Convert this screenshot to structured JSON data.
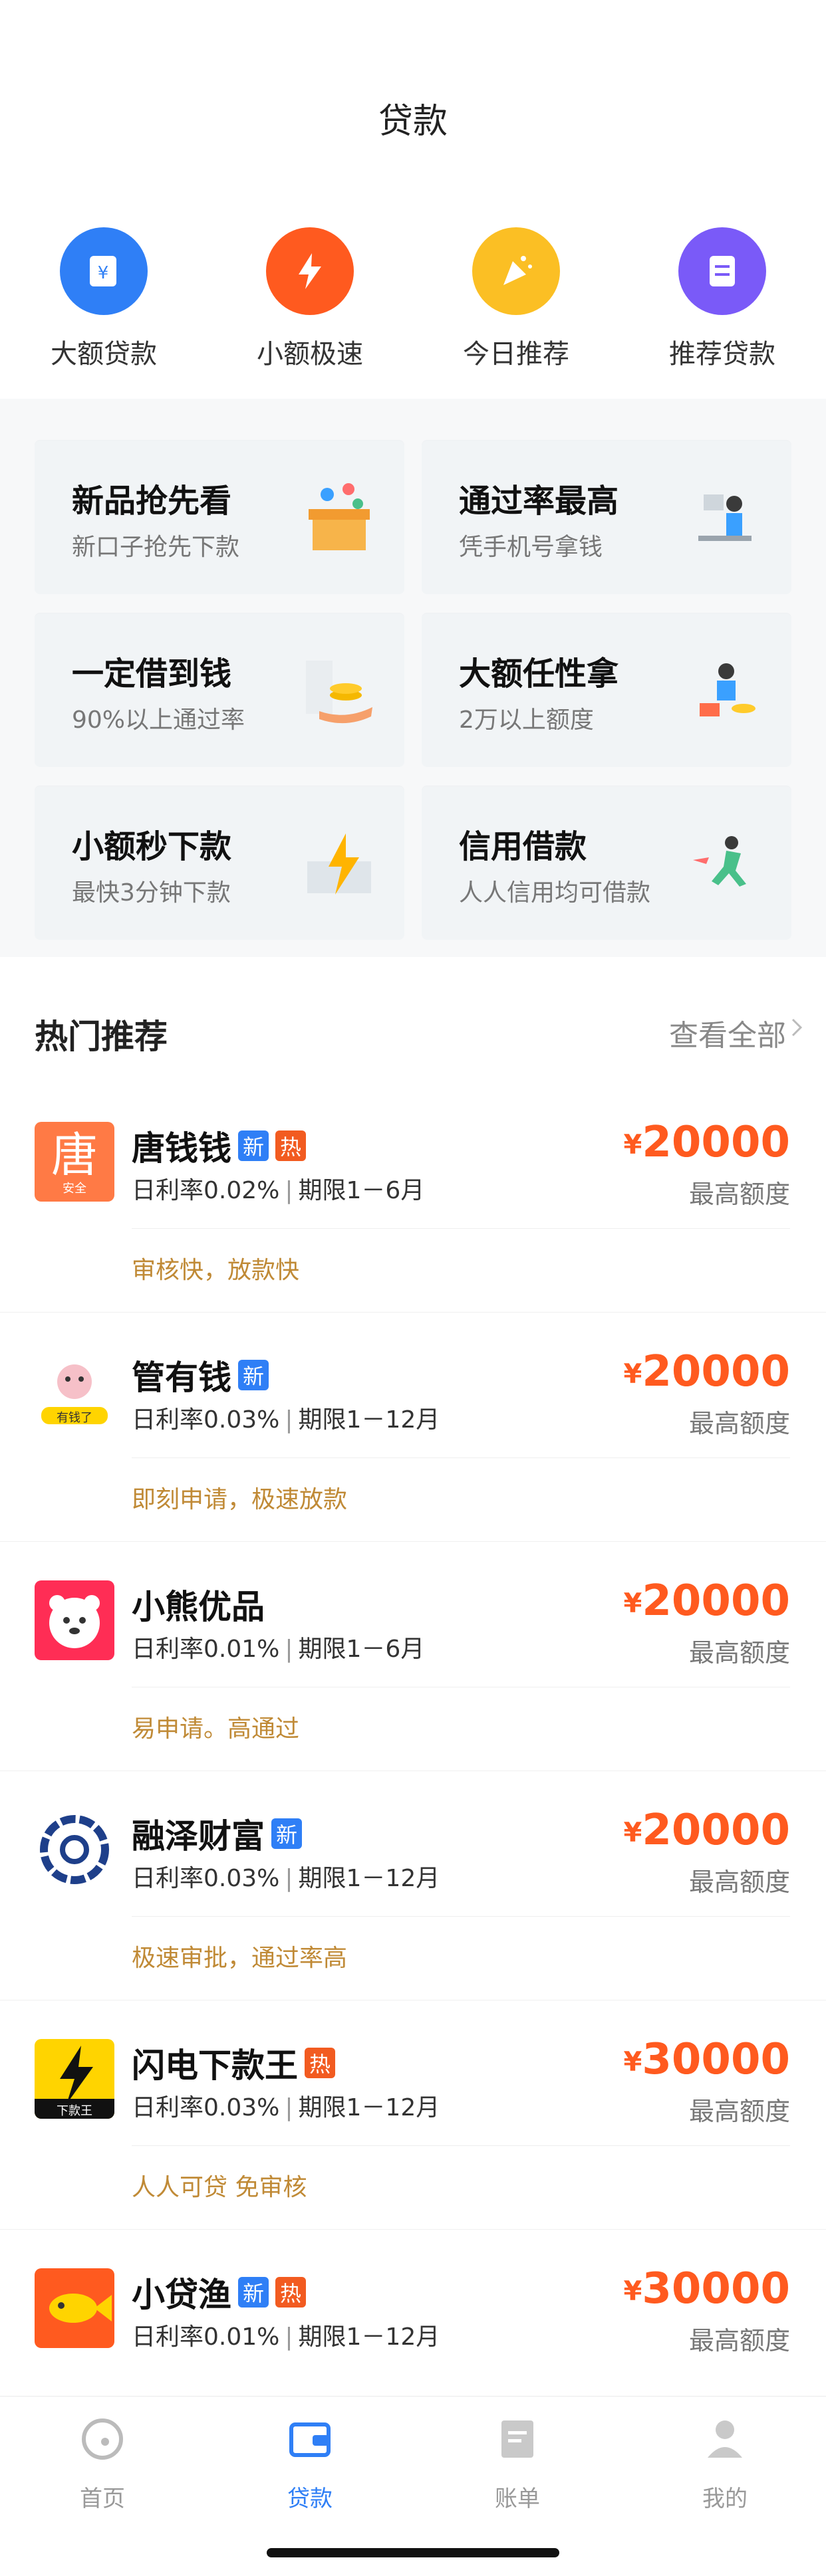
{
  "header": {
    "title": "贷款"
  },
  "categories": [
    {
      "label": "大额贷款",
      "icon": "big-loan-icon",
      "color": "#2f7ff6"
    },
    {
      "label": "小额极速",
      "icon": "lightning-icon",
      "color": "#ff5a1f"
    },
    {
      "label": "今日推荐",
      "icon": "party-icon",
      "color": "#fbbf24"
    },
    {
      "label": "推荐贷款",
      "icon": "list-icon",
      "color": "#7a5af8"
    }
  ],
  "tiles": [
    {
      "title": "新品抢先看",
      "subtitle": "新口子抢先下款"
    },
    {
      "title": "通过率最高",
      "subtitle": "凭手机号拿钱"
    },
    {
      "title": "一定借到钱",
      "subtitle": "90%以上通过率"
    },
    {
      "title": "大额任性拿",
      "subtitle": "2万以上额度"
    },
    {
      "title": "小额秒下款",
      "subtitle": "最快3分钟下款"
    },
    {
      "title": "信用借款",
      "subtitle": "人人信用均可借款"
    }
  ],
  "hot": {
    "title": "热门推荐",
    "more": "查看全部"
  },
  "currency": "¥",
  "amount_label": "最高额度",
  "items": [
    {
      "name": "唐钱钱",
      "badges": [
        "新",
        "热"
      ],
      "rate": "日利率0.02%",
      "term": "期限1－6月",
      "amount": "20000",
      "tag": "审核快，放款快",
      "logo_text": "唐",
      "logo_sub": "安全"
    },
    {
      "name": "管有钱",
      "badges": [
        "新"
      ],
      "rate": "日利率0.03%",
      "term": "期限1－12月",
      "amount": "20000",
      "tag": "即刻申请，极速放款",
      "logo_text": "",
      "logo_sub": "有钱了"
    },
    {
      "name": "小熊优品",
      "badges": [],
      "rate": "日利率0.01%",
      "term": "期限1－6月",
      "amount": "20000",
      "tag": "易申请。高通过",
      "logo_text": "",
      "logo_sub": ""
    },
    {
      "name": "融泽财富",
      "badges": [
        "新"
      ],
      "rate": "日利率0.03%",
      "term": "期限1－12月",
      "amount": "20000",
      "tag": "极速审批，通过率高",
      "logo_text": "",
      "logo_sub": ""
    },
    {
      "name": "闪电下款王",
      "badges": [
        "热"
      ],
      "rate": "日利率0.03%",
      "term": "期限1－12月",
      "amount": "30000",
      "tag": "人人可贷 免审核",
      "logo_text": "",
      "logo_sub": "下款王"
    },
    {
      "name": "小贷渔",
      "badges": [
        "新",
        "热"
      ],
      "rate": "日利率0.01%",
      "term": "期限1－12月",
      "amount": "30000",
      "tag": "",
      "logo_text": "",
      "logo_sub": ""
    }
  ],
  "tabs": [
    {
      "label": "首页",
      "icon": "home-icon"
    },
    {
      "label": "贷款",
      "icon": "wallet-icon",
      "active": true
    },
    {
      "label": "账单",
      "icon": "bill-icon"
    },
    {
      "label": "我的",
      "icon": "user-icon"
    }
  ]
}
